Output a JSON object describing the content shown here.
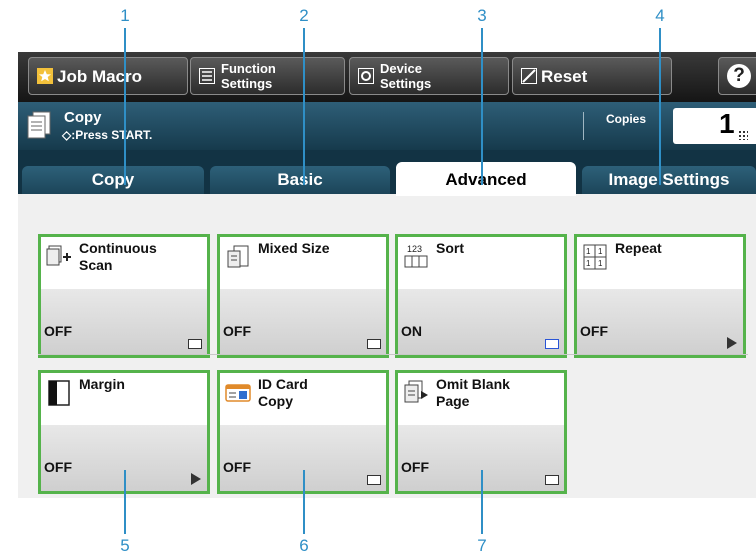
{
  "callouts": [
    "1",
    "2",
    "3",
    "4",
    "5",
    "6",
    "7"
  ],
  "topbar": {
    "job_macro": "Job Macro",
    "function_settings": "Function\nSettings",
    "device_settings": "Device\nSettings",
    "reset": "Reset",
    "help": "?"
  },
  "status": {
    "title": "Copy",
    "message": "◇:Press START.",
    "copies_label": "Copies",
    "copies_value": "1"
  },
  "tabs": [
    "Copy",
    "Basic",
    "Advanced",
    "Image Settings"
  ],
  "active_tab": "Advanced",
  "cards": [
    {
      "name": "Continuous\nScan",
      "value": "OFF",
      "icon": "continuous-scan-icon",
      "marker": "rect"
    },
    {
      "name": "Mixed Size",
      "value": "OFF",
      "icon": "mixed-size-icon",
      "marker": "rect"
    },
    {
      "name": "Sort",
      "value": "ON",
      "icon": "sort-icon",
      "marker": "rect-on"
    },
    {
      "name": "Repeat",
      "value": "OFF",
      "icon": "repeat-icon",
      "marker": "arrow"
    },
    {
      "name": "Margin",
      "value": "OFF",
      "icon": "margin-icon",
      "marker": "arrow"
    },
    {
      "name": "ID Card\nCopy",
      "value": "OFF",
      "icon": "id-card-icon",
      "marker": "rect"
    },
    {
      "name": "Omit Blank\nPage",
      "value": "OFF",
      "icon": "omit-blank-page-icon",
      "marker": "rect"
    }
  ],
  "colors": {
    "callout": "#2f8fc6",
    "card_border": "#55b34b",
    "header": "#1e4a5e"
  }
}
